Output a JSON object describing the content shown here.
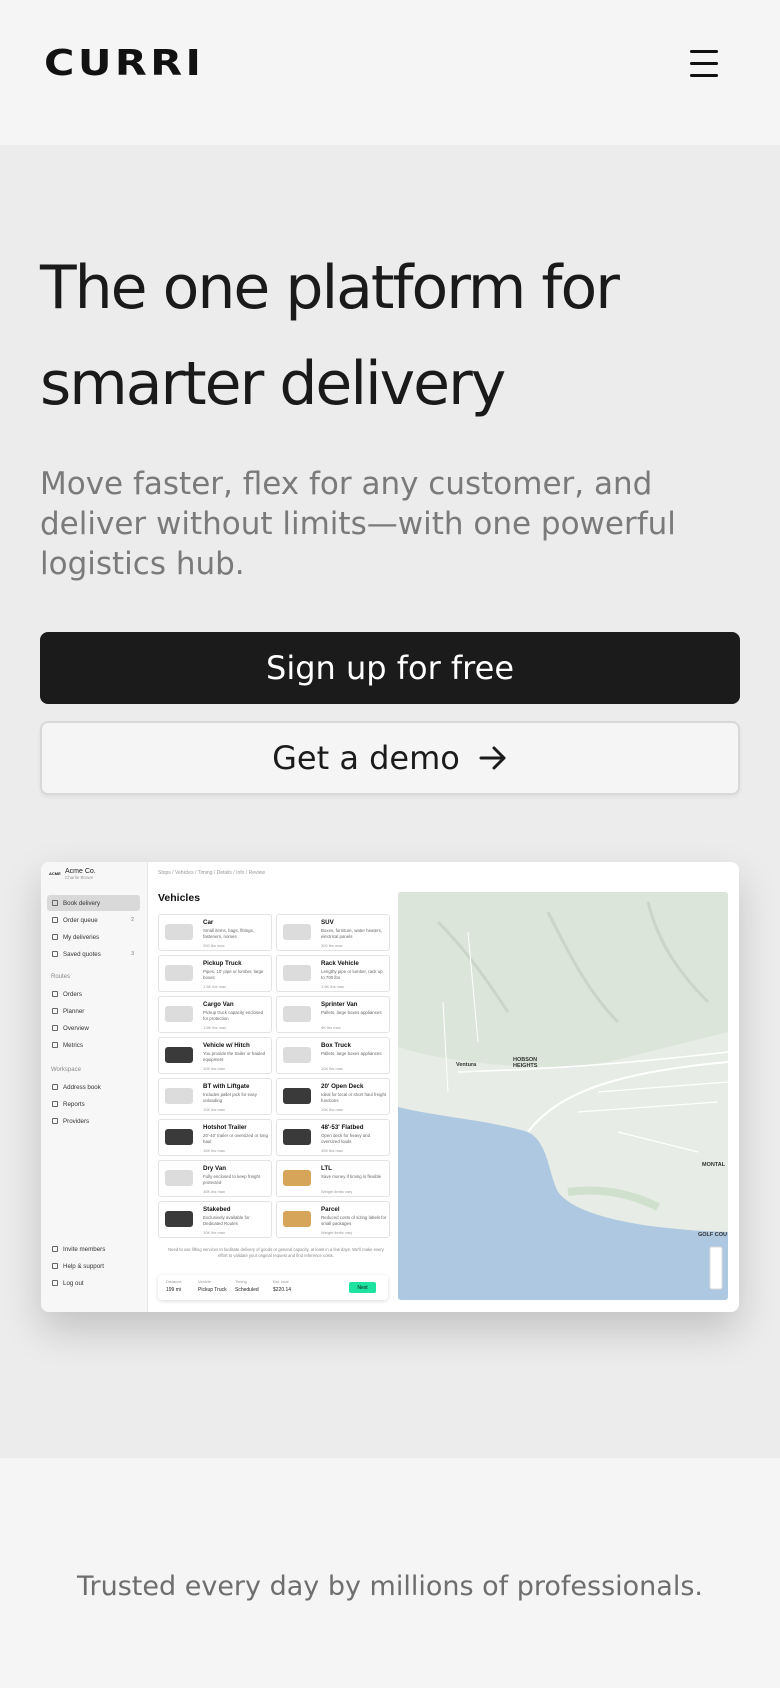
{
  "header": {
    "logo": "CURRI",
    "menu_icon": "hamburger-menu-icon"
  },
  "hero": {
    "title_line1": "The one platform for",
    "title_line2": "smarter delivery",
    "subtitle": "Move faster, flex for any customer, and deliver without limits—with one powerful logistics hub.",
    "primary_cta": "Sign up for free",
    "secondary_cta": "Get a demo",
    "secondary_cta_icon": "arrow-right-icon"
  },
  "app_screenshot": {
    "org_name": "Acme Co.",
    "org_sub": "Charlie Brown",
    "sidebar": {
      "items": [
        {
          "label": "Book delivery",
          "active": true
        },
        {
          "label": "Order queue",
          "count": "2"
        },
        {
          "label": "My deliveries"
        },
        {
          "label": "Saved quotes",
          "count": "3"
        }
      ],
      "routes_label": "Routes",
      "routes_items": [
        "Orders",
        "Planner",
        "Overview",
        "Metrics"
      ],
      "workspace_label": "Workspace",
      "workspace_items": [
        "Address book",
        "Reports",
        "Providers"
      ],
      "bottom_items": [
        "Invite members",
        "Help & support",
        "Log out"
      ]
    },
    "breadcrumb": "Stops / Vehicles / Timing / Details / Info / Review",
    "vehicles_title": "Vehicles",
    "vehicles": [
      {
        "name": "Car",
        "desc": "Small items, bags, fittings, fasteners, nomes",
        "max": "200 lbs max"
      },
      {
        "name": "SUV",
        "desc": "Boxes, furniture, water heaters, electrical panels",
        "max": "300 lbs max"
      },
      {
        "name": "Pickup Truck",
        "desc": "Pipes, 10' pipe or lumber, large boxes",
        "max": "1.5K lbs max"
      },
      {
        "name": "Rack Vehicle",
        "desc": "Lengthy pipe or lumber, rack up to 700 lbs",
        "max": "1.5K lbs max"
      },
      {
        "name": "Cargo Van",
        "desc": "Pickup truck capacity enclosed for protection",
        "max": "1.5K lbs max"
      },
      {
        "name": "Sprinter Van",
        "desc": "Pallets, large boxes appliances",
        "max": "4K lbs max"
      },
      {
        "name": "Vehicle w/ Hitch",
        "desc": "You provide the trailer or hauled equipment",
        "max": "10K lbs max"
      },
      {
        "name": "Box Truck",
        "desc": "Pallets, large boxes appliances",
        "max": "10K lbs max"
      },
      {
        "name": "BT with Liftgate",
        "desc": "Includes pallet jack for easy unloading",
        "max": "10K lbs max"
      },
      {
        "name": "20' Open Deck",
        "desc": "Ideal for local or short haul freight functions",
        "max": "10K lbs max"
      },
      {
        "name": "Hotshot Trailer",
        "desc": "20'-40' trailer or oversized or long haul",
        "max": "15K lbs max"
      },
      {
        "name": "48'-53' Flatbed",
        "desc": "Open deck for heavy and oversized loads",
        "max": "45K lbs max"
      },
      {
        "name": "Dry Van",
        "desc": "Fully enclosed to keep freight protected",
        "max": "45K lbs max"
      },
      {
        "name": "LTL",
        "desc": "Save money if timing is flexible",
        "max": "Weight limits vary"
      },
      {
        "name": "Stakebed",
        "desc": "Exclusively available for Dedicated Routes",
        "max": "10K lbs max"
      },
      {
        "name": "Parcel",
        "desc": "Reduced costs of sizing labels for small packages",
        "max": "Weight limits vary"
      }
    ],
    "note": "Need to use lifting services to facilitate delivery of goods or general capacity, at least in a few days. We'll make every effort to validate your original request and find reference costs.",
    "footer": {
      "col1_label": "Distance",
      "col1_value": "199 mi",
      "col2_label": "Vehicle",
      "col2_value": "Pickup Truck",
      "col3_label": "Timing",
      "col3_value": "Scheduled",
      "col4_label": "Est. total",
      "col4_value": "$220.14",
      "next": "Next"
    },
    "map_labels": [
      "Ventura",
      "HOBSON HEIGHTS",
      "MONTAL",
      "GOLF COU"
    ]
  },
  "trusted_text": "Trusted every day by millions of professionals.",
  "colors": {
    "page_bg": "#f5f5f5",
    "hero_bg": "#ececec",
    "primary": "#1b1b1b",
    "accent_green": "#1de2a0",
    "water": "#adc8e0"
  }
}
